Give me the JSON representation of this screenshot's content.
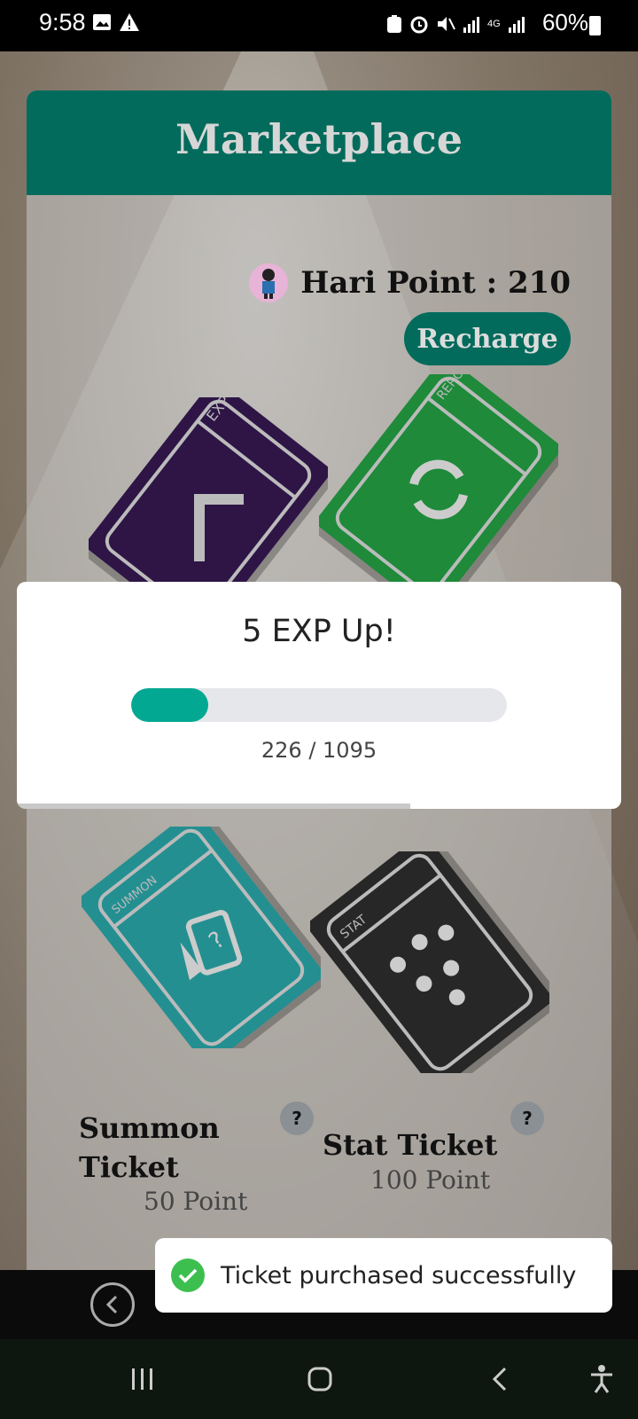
{
  "status_bar": {
    "time": "9:58",
    "network_label": "4G",
    "battery": "60%"
  },
  "marketplace": {
    "title": "Marketplace",
    "points_label": "Hari Point : 210",
    "recharge_label": "Recharge"
  },
  "tickets": {
    "exp": {
      "tag": "EXP",
      "color": "#2e1546"
    },
    "reroll": {
      "tag": "REROLL",
      "color": "#1f8a3a"
    },
    "summon": {
      "tag": "SUMMON",
      "color": "#248f91",
      "name_line1": "Summon",
      "name_line2": "Ticket",
      "price": "50 Point",
      "help": "?"
    },
    "stat": {
      "tag": "STAT",
      "color": "#272727",
      "name": "Stat Ticket",
      "price": "100 Point",
      "help": "?"
    }
  },
  "modal": {
    "title": "5 EXP Up!",
    "progress_text": "226 / 1095",
    "progress_fraction": 0.206,
    "accent": "#03a893"
  },
  "toast": {
    "message": "Ticket purchased successfully",
    "icon": "check-circle-icon"
  },
  "colors": {
    "brand": "#036b5c"
  }
}
